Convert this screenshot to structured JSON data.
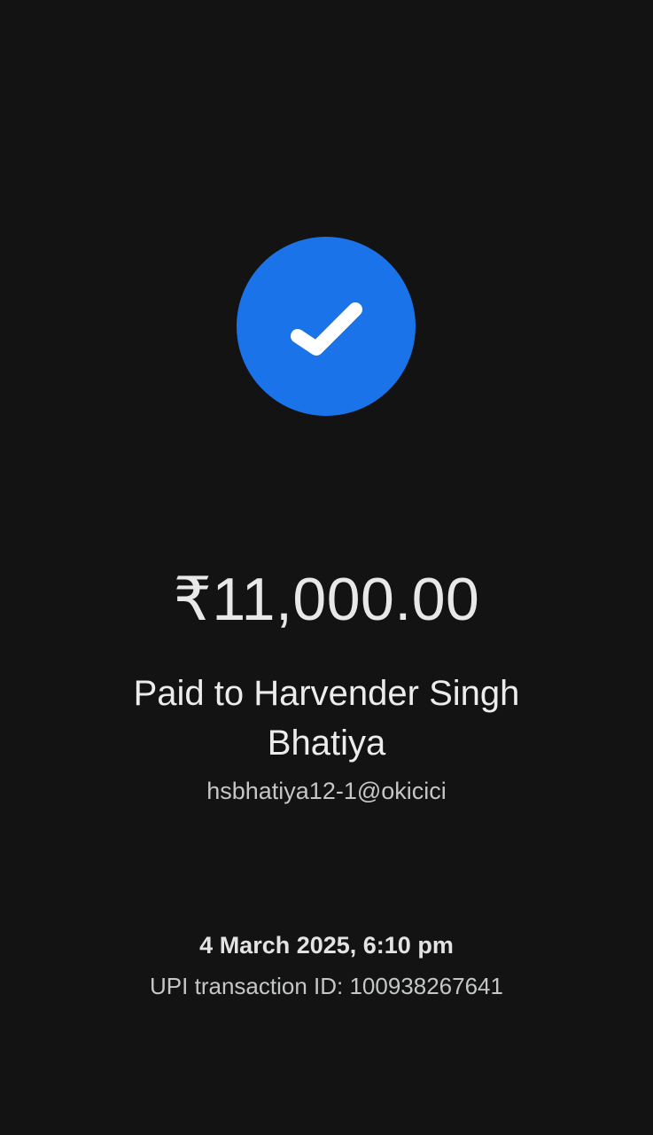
{
  "status": {
    "icon": "check-icon",
    "circle_color": "#1a73e8"
  },
  "payment": {
    "amount": "₹11,000.00",
    "payee_line": "Paid to Harvender Singh Bhatiya",
    "upi_id": "hsbhatiya12-1@okicici",
    "datetime": "4 March 2025, 6:10 pm",
    "transaction_id": "UPI transaction ID: 100938267641"
  }
}
